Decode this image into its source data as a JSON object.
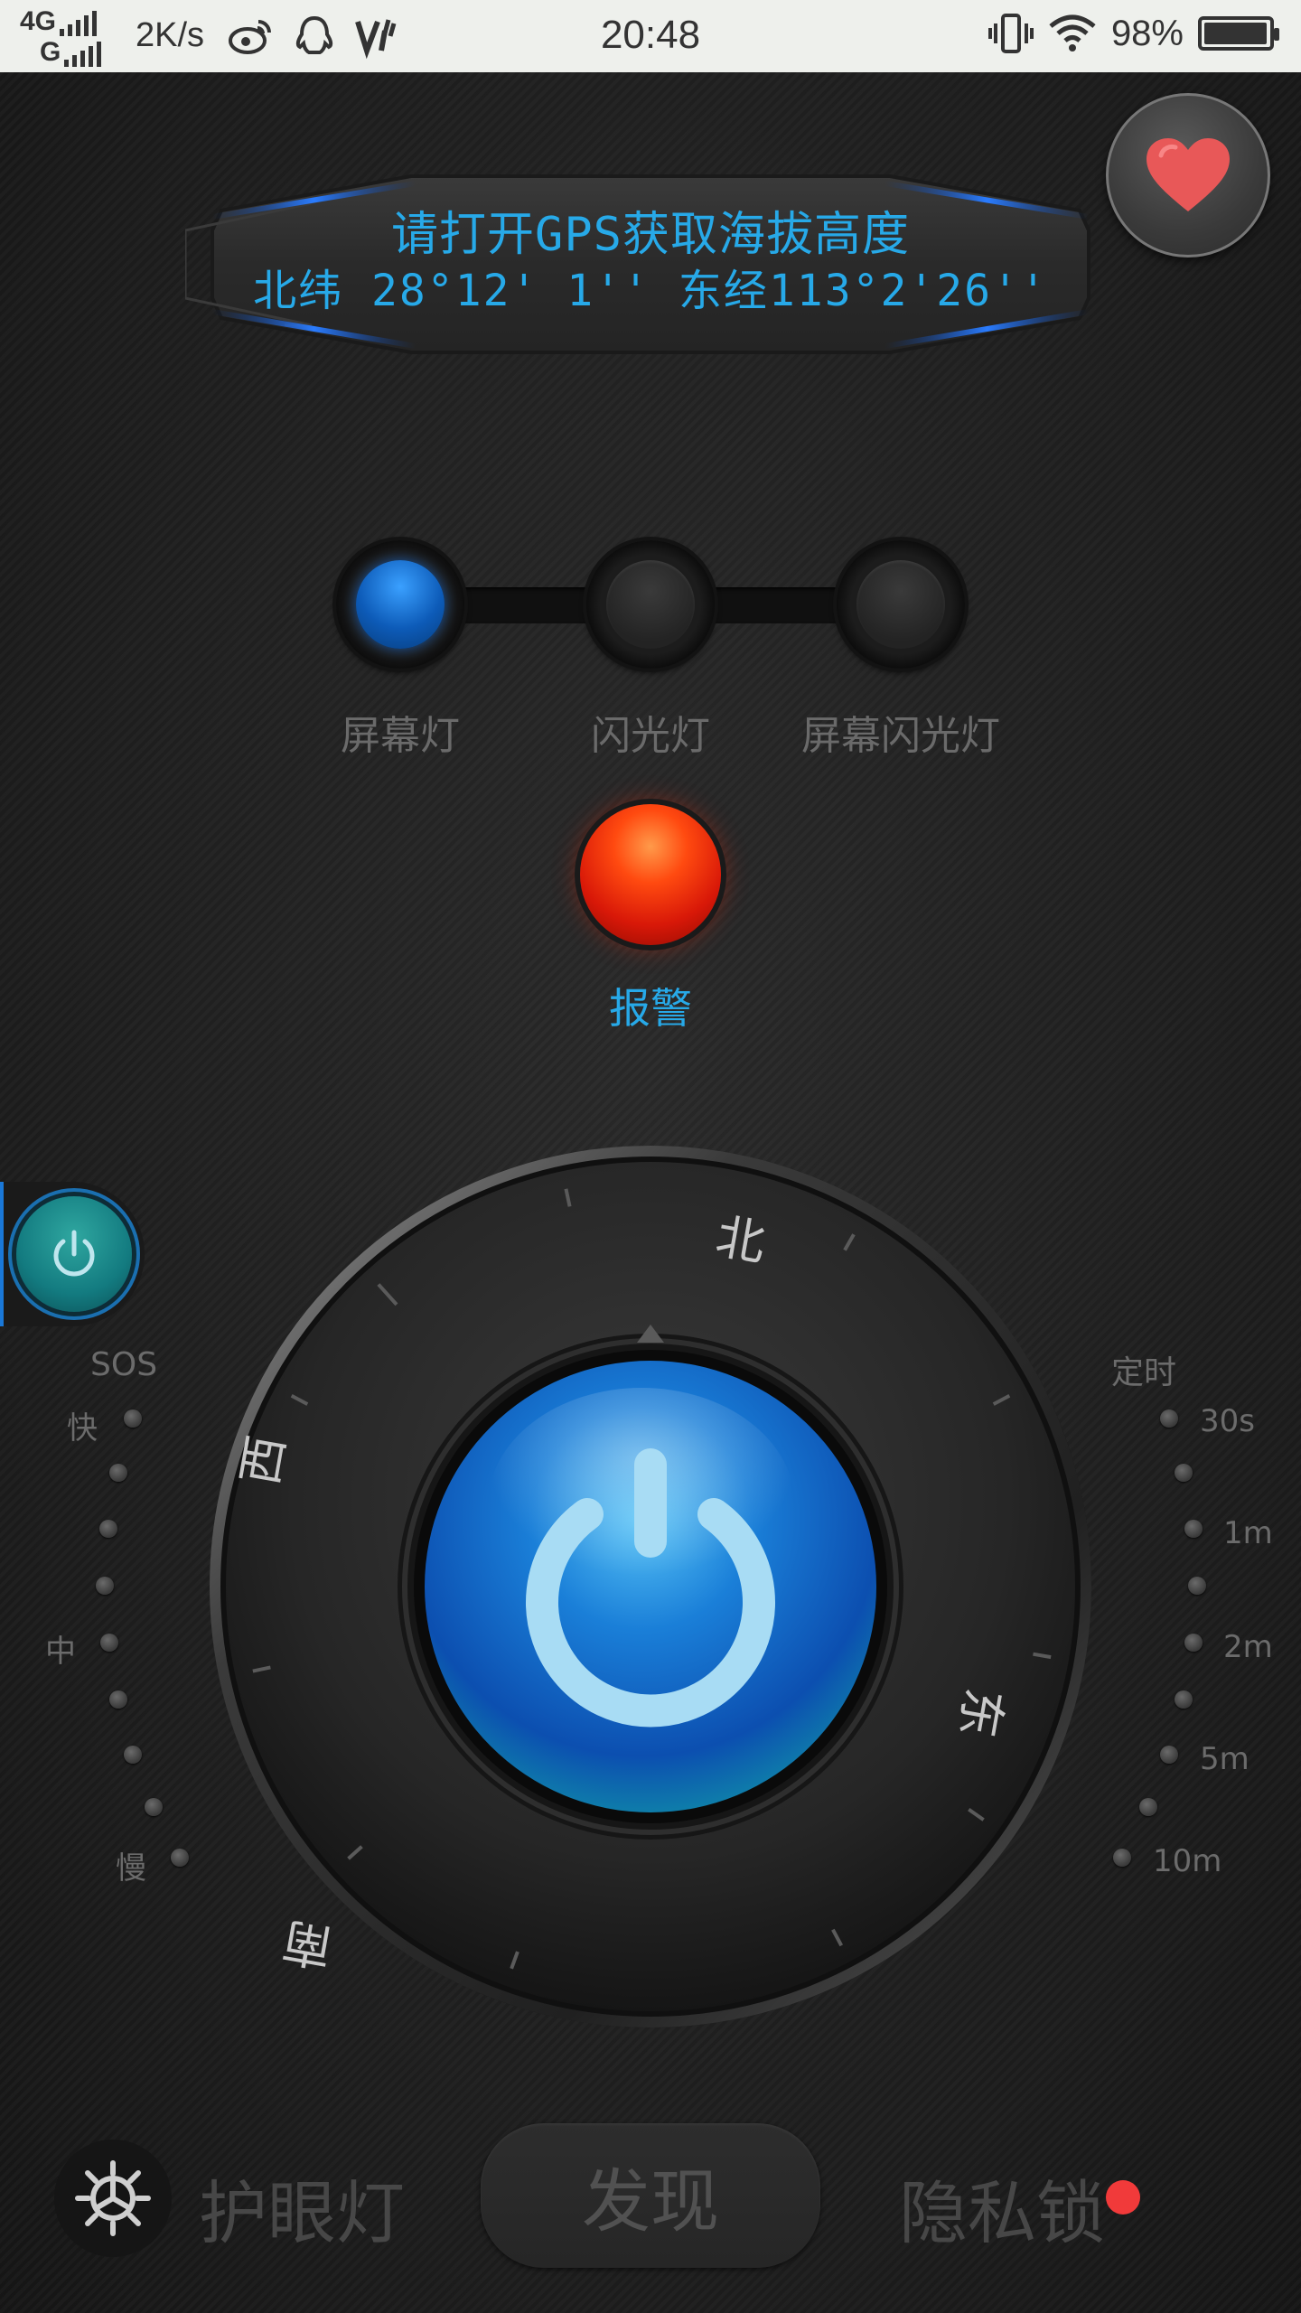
{
  "status_bar": {
    "network_top": "4G",
    "network_bottom": "G",
    "speed": "2K/s",
    "time": "20:48",
    "battery_percent": "98%",
    "icons": [
      "weibo-icon",
      "qq-icon",
      "vivo-icon",
      "vibrate-icon",
      "wifi-icon",
      "battery-icon"
    ]
  },
  "gps": {
    "title": "请打开GPS获取海拔高度",
    "coordinates": "北纬 28°12' 1''  东经113°2'26''"
  },
  "modes": {
    "items": [
      {
        "label": "屏幕灯",
        "active": true
      },
      {
        "label": "闪光灯",
        "active": false
      },
      {
        "label": "屏幕闪光灯",
        "active": false
      }
    ]
  },
  "alarm": {
    "label": "报警"
  },
  "sos": {
    "title": "SOS",
    "labels": [
      "快",
      "中",
      "慢"
    ]
  },
  "timer": {
    "title": "定时",
    "labels": [
      "30s",
      "1m",
      "2m",
      "5m",
      "10m"
    ]
  },
  "compass": {
    "north": "北",
    "east": "东",
    "south": "南",
    "west": "西"
  },
  "bottom_nav": {
    "eye_light": "护眼灯",
    "discover": "发现",
    "privacy_lock": "隐私锁"
  },
  "colors": {
    "accent_blue": "#27a9e8",
    "alarm_red": "#ff3a10",
    "badge_red": "#f13a3a"
  }
}
